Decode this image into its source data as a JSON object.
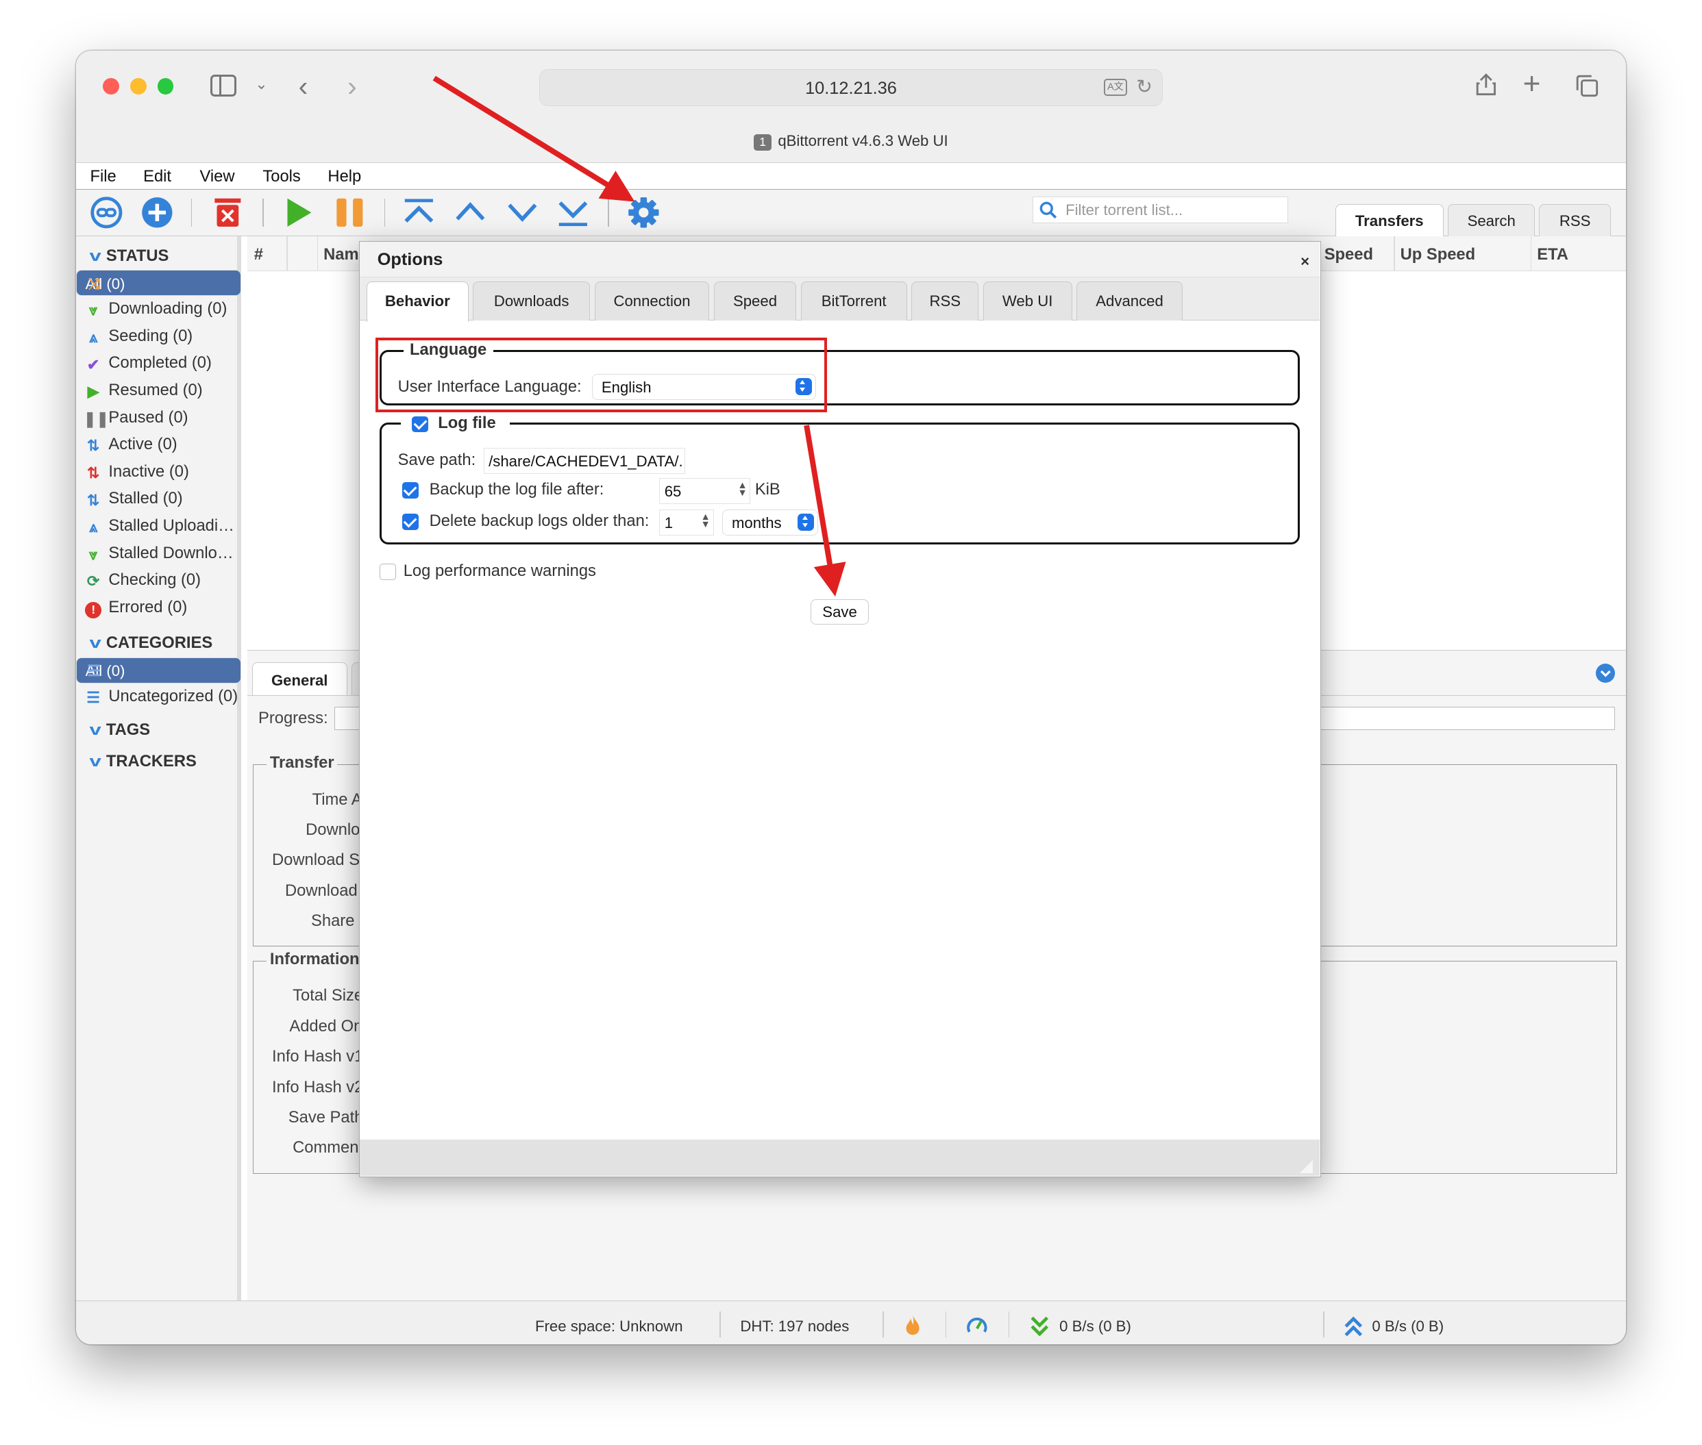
{
  "browser": {
    "url": "10.12.21.36",
    "tab_count": "1",
    "tab_title": "qBittorrent v4.6.3 Web UI"
  },
  "menu": [
    "File",
    "Edit",
    "View",
    "Tools",
    "Help"
  ],
  "toolbar": {
    "icons": [
      "add-link-icon",
      "add-torrent-icon",
      "delete-icon",
      "resume-icon",
      "pause-icon",
      "top-priority-icon",
      "increase-priority-icon",
      "decrease-priority-icon",
      "bottom-priority-icon",
      "options-gear-icon"
    ],
    "filter_placeholder": "Filter torrent list..."
  },
  "right_tabs": [
    "Transfers",
    "Search",
    "RSS"
  ],
  "sidebar": {
    "status_header": "STATUS",
    "status_items": [
      {
        "label": "All (0)",
        "icon": "all-icon"
      },
      {
        "label": "Downloading (0)",
        "icon": "downloading-icon"
      },
      {
        "label": "Seeding (0)",
        "icon": "seeding-icon"
      },
      {
        "label": "Completed (0)",
        "icon": "completed-icon"
      },
      {
        "label": "Resumed (0)",
        "icon": "resumed-icon"
      },
      {
        "label": "Paused (0)",
        "icon": "paused-icon"
      },
      {
        "label": "Active (0)",
        "icon": "active-icon"
      },
      {
        "label": "Inactive (0)",
        "icon": "inactive-icon"
      },
      {
        "label": "Stalled (0)",
        "icon": "stalled-icon"
      },
      {
        "label": "Stalled Uploadi…",
        "icon": "stalled-uploading-icon"
      },
      {
        "label": "Stalled Downlo…",
        "icon": "stalled-downloading-icon"
      },
      {
        "label": "Checking (0)",
        "icon": "checking-icon"
      },
      {
        "label": "Errored (0)",
        "icon": "errored-icon"
      }
    ],
    "categories_header": "CATEGORIES",
    "category_items": [
      "All (0)",
      "Uncategorized (0)"
    ],
    "tags_header": "TAGS",
    "trackers_header": "TRACKERS"
  },
  "table_headers": {
    "hash": "#",
    "name": "Nam",
    "dl_speed": "Speed",
    "up_speed": "Up Speed",
    "eta": "ETA"
  },
  "details": {
    "tab_general": "General",
    "progress_label": "Progress:",
    "transfer_legend": "Transfer",
    "transfer_labels": [
      "Time A",
      "Downlo",
      "Download S",
      "Download",
      "Share"
    ],
    "information_legend": "Information",
    "information_labels": [
      "Total Size",
      "Added On",
      "Info Hash v1",
      "Info Hash v2",
      "Save Path",
      "Comment"
    ]
  },
  "statusbar": {
    "free_space": "Free space: Unknown",
    "dht": "DHT: 197 nodes",
    "download": "0 B/s (0 B)",
    "upload": "0 B/s (0 B)"
  },
  "dialog": {
    "title": "Options",
    "close": "×",
    "tabs": [
      "Behavior",
      "Downloads",
      "Connection",
      "Speed",
      "BitTorrent",
      "RSS",
      "Web UI",
      "Advanced"
    ],
    "active_tab": "Behavior",
    "language_legend": "Language",
    "ui_language_label": "User Interface Language:",
    "ui_language_value": "English",
    "logfile_legend": "Log file",
    "logfile_enabled": true,
    "save_path_label": "Save path:",
    "save_path_value": "/share/CACHEDEV1_DATA/.",
    "backup_label": "Backup the log file after:",
    "backup_checked": true,
    "backup_value": "65",
    "backup_unit": "KiB",
    "delete_label": "Delete backup logs older than:",
    "delete_checked": true,
    "delete_value": "1",
    "delete_unit": "months",
    "perf_warnings_label": "Log performance warnings",
    "perf_warnings_checked": false,
    "save_button": "Save"
  },
  "colors": {
    "selection": "#4b6fa8",
    "accent_blue": "#1f73e8",
    "icon_blue": "#3583d8",
    "annotation_red": "#e02020"
  }
}
